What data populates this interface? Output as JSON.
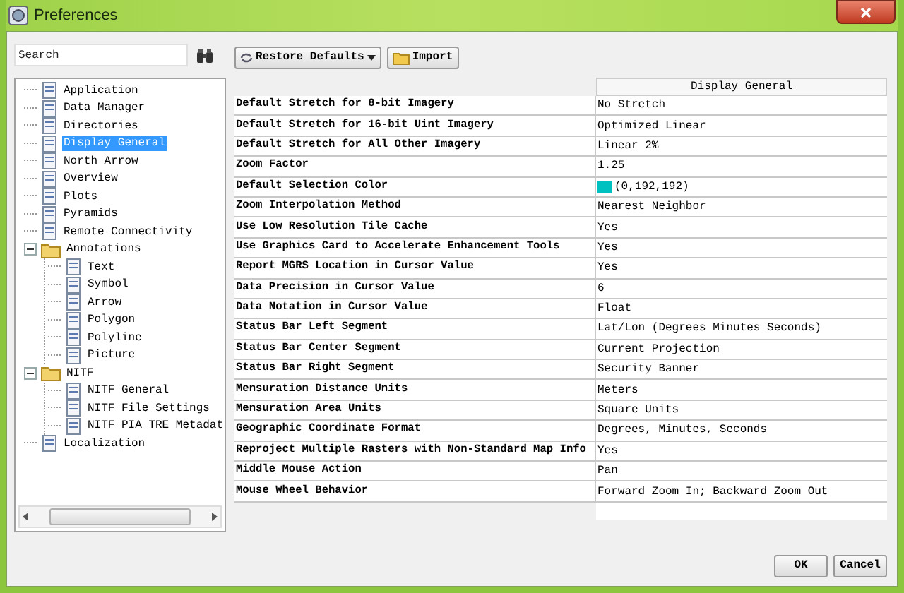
{
  "window": {
    "title": "Preferences"
  },
  "search": {
    "placeholder": "Search"
  },
  "toolbar": {
    "restore_defaults": "Restore Defaults",
    "import": "Import"
  },
  "tree": [
    {
      "label": "Application",
      "selected": false
    },
    {
      "label": "Data Manager",
      "selected": false
    },
    {
      "label": "Directories",
      "selected": false
    },
    {
      "label": "Display General",
      "selected": true
    },
    {
      "label": "North Arrow",
      "selected": false
    },
    {
      "label": "Overview",
      "selected": false
    },
    {
      "label": "Plots",
      "selected": false
    },
    {
      "label": "Pyramids",
      "selected": false
    },
    {
      "label": "Remote Connectivity",
      "selected": false
    },
    {
      "label": "Annotations",
      "selected": false,
      "expanded": true,
      "children": [
        {
          "label": "Text",
          "selected": false
        },
        {
          "label": "Symbol",
          "selected": false
        },
        {
          "label": "Arrow",
          "selected": false
        },
        {
          "label": "Polygon",
          "selected": false
        },
        {
          "label": "Polyline",
          "selected": false
        },
        {
          "label": "Picture",
          "selected": false
        }
      ]
    },
    {
      "label": "NITF",
      "selected": false,
      "expanded": true,
      "children": [
        {
          "label": "NITF General",
          "selected": false
        },
        {
          "label": "NITF File Settings",
          "selected": false
        },
        {
          "label": "NITF PIA TRE Metadat",
          "selected": false
        }
      ]
    },
    {
      "label": "Localization",
      "selected": false
    }
  ],
  "table": {
    "column_header": "Display General",
    "rows": [
      {
        "label": "Default Stretch for 8-bit Imagery",
        "value": "No Stretch"
      },
      {
        "label": "Default Stretch for 16-bit Uint Imagery",
        "value": "Optimized Linear"
      },
      {
        "label": "Default Stretch for All Other Imagery",
        "value": "Linear 2%"
      },
      {
        "label": "Zoom Factor",
        "value": "1.25"
      },
      {
        "label": "Default Selection Color",
        "value": "(0,192,192)",
        "color": "#00c0c0"
      },
      {
        "label": "Zoom Interpolation Method",
        "value": "Nearest Neighbor"
      },
      {
        "label": "Use Low Resolution Tile Cache",
        "value": "Yes"
      },
      {
        "label": "Use Graphics Card to Accelerate Enhancement Tools",
        "value": "Yes"
      },
      {
        "label": "Report MGRS Location in Cursor Value",
        "value": "Yes"
      },
      {
        "label": "Data Precision in Cursor Value",
        "value": "6"
      },
      {
        "label": "Data Notation in Cursor Value",
        "value": "Float"
      },
      {
        "label": "Status Bar Left Segment",
        "value": "Lat/Lon (Degrees Minutes Seconds)"
      },
      {
        "label": "Status Bar Center Segment",
        "value": "Current Projection"
      },
      {
        "label": "Status Bar Right Segment",
        "value": "Security Banner"
      },
      {
        "label": "Mensuration Distance Units",
        "value": "Meters"
      },
      {
        "label": "Mensuration Area Units",
        "value": "Square Units"
      },
      {
        "label": "Geographic Coordinate Format",
        "value": "Degrees, Minutes, Seconds"
      },
      {
        "label": "Reproject Multiple Rasters with Non-Standard Map Info",
        "value": "Yes"
      },
      {
        "label": "Middle Mouse Action",
        "value": "Pan"
      },
      {
        "label": "Mouse Wheel Behavior",
        "value": "Forward Zoom In; Backward Zoom Out"
      }
    ]
  },
  "buttons": {
    "ok": "OK",
    "cancel": "Cancel"
  }
}
